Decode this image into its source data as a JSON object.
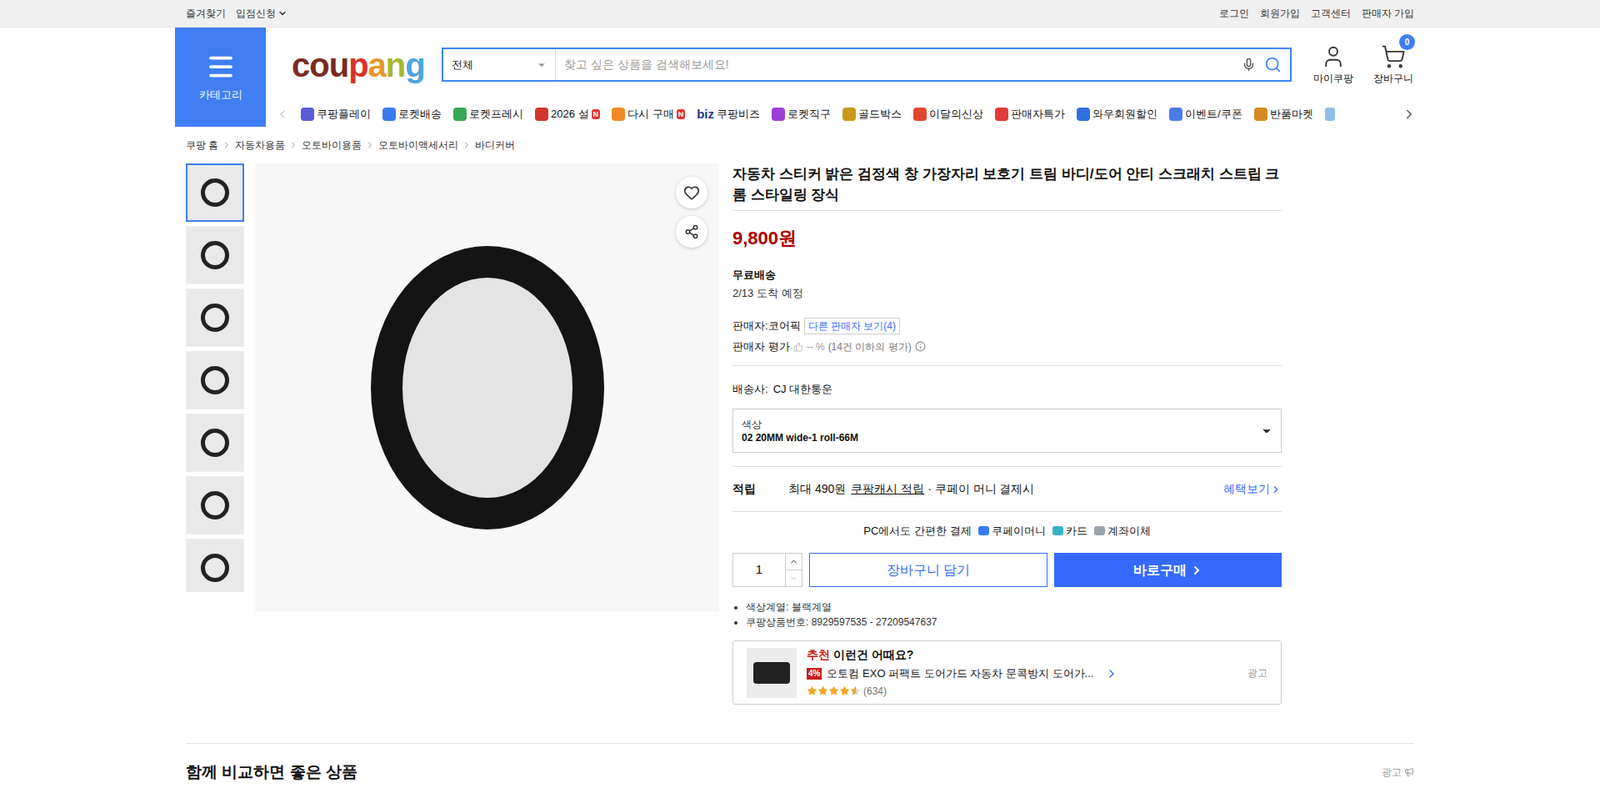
{
  "top_bar": {
    "left": [
      "즐겨찾기",
      "입점신청"
    ],
    "right": [
      "로그인",
      "회원가입",
      "고객센터",
      "판매자 가입"
    ]
  },
  "header": {
    "category_label": "카테고리",
    "logo": [
      {
        "text": "cou",
        "color": "#7a2b22"
      },
      {
        "text": "p",
        "color": "#d9312a"
      },
      {
        "text": "a",
        "color": "#e9962b"
      },
      {
        "text": "n",
        "color": "#a5b72f"
      },
      {
        "text": "g",
        "color": "#4aa6de"
      }
    ],
    "search_scope": "전체",
    "search_placeholder": "찾고 싶은 상품을 검색해보세요!",
    "my_label": "마이쿠팡",
    "cart_label": "장바구니",
    "cart_count": "0"
  },
  "nav": [
    {
      "label": "쿠팡플레이",
      "prefix": "",
      "badge": "",
      "color": "#5b5bd6"
    },
    {
      "label": "로켓배송",
      "prefix": "",
      "badge": "",
      "color": "#3a7bf0"
    },
    {
      "label": "로켓프레시",
      "prefix": "",
      "badge": "",
      "color": "#39a855"
    },
    {
      "label": "2026 설",
      "prefix": "",
      "badge": "N",
      "color": "#d2352c"
    },
    {
      "label": "다시 구매",
      "prefix": "",
      "badge": "N",
      "color": "#f08a24"
    },
    {
      "label": "쿠팡비즈",
      "prefix": "biz",
      "badge": "",
      "color": "#1e3a8a"
    },
    {
      "label": "로켓직구",
      "prefix": "",
      "badge": "",
      "color": "#9b3fd6"
    },
    {
      "label": "골드박스",
      "prefix": "",
      "badge": "",
      "color": "#c99a1a"
    },
    {
      "label": "이달의신상",
      "prefix": "",
      "badge": "",
      "color": "#e0452e"
    },
    {
      "label": "판매자특가",
      "prefix": "",
      "badge": "",
      "color": "#e23b3b"
    },
    {
      "label": "와우회원할인",
      "prefix": "",
      "badge": "",
      "color": "#2f6fe0"
    },
    {
      "label": "이벤트/쿠폰",
      "prefix": "",
      "badge": "",
      "color": "#4b7be6"
    },
    {
      "label": "반품마켓",
      "prefix": "",
      "badge": "",
      "color": "#d48a1e"
    }
  ],
  "breadcrumb": [
    "쿠팡 홈",
    "자동차용품",
    "오토바이용품",
    "오토바이액세서리",
    "바디커버"
  ],
  "thumbnails": [
    {
      "selected": true
    },
    {
      "selected": false
    },
    {
      "selected": false
    },
    {
      "selected": false
    },
    {
      "selected": false
    },
    {
      "selected": false
    },
    {
      "selected": false
    }
  ],
  "product": {
    "title": "자동차 스티커 밝은 검정색 창 가장자리 보호기 트림 바디/도어 안티 스크래치 스트립 크롬 스타일링 장식",
    "price": "9,800원",
    "shipping_label": "무료배송",
    "arrival": "2/13 도착 예정",
    "seller_label": "판매자:",
    "seller": "코어픽",
    "other_sellers": "다른 판매자 보기(4)",
    "rating_label": "판매자 평가",
    "rating_value": "-- %",
    "rating_note": "(14건 이하의 평가)",
    "carrier_label": "배송사:",
    "carrier": "CJ 대한통운",
    "option_label": "색상",
    "option_value": "02 20MM wide-1 roll-66M",
    "reward_label": "적립",
    "reward_amount": "최대 490원",
    "reward_link": "쿠팡캐시 적립",
    "reward_note": "· 쿠페이 머니 결제시",
    "benefit_link": "혜택보기",
    "pay_label": "PC에서도 간편한 결제",
    "pay_methods": [
      {
        "label": "쿠페이머니",
        "color": "#3a7bf0"
      },
      {
        "label": "카드",
        "color": "#38b2c9"
      },
      {
        "label": "계좌이체",
        "color": "#9aa3ad"
      }
    ],
    "quantity": "1",
    "cart_button": "장바구니 담기",
    "buy_button": "바로구매",
    "details": [
      "색상계열: 블랙계열",
      "쿠팡상품번호: 8929597535 - 27209547637"
    ]
  },
  "ad": {
    "tag": "추천",
    "heading": "이런건 어때요?",
    "discount": "4%",
    "title": "오토컴 EXO 퍼팩트 도어가드 자동차 문콕방지 도어가...",
    "stars": 4.5,
    "reviews": "(634)",
    "ad_label": "광고"
  },
  "section": {
    "title": "함께 비교하면 좋은 상품",
    "ad_label": "광고"
  }
}
